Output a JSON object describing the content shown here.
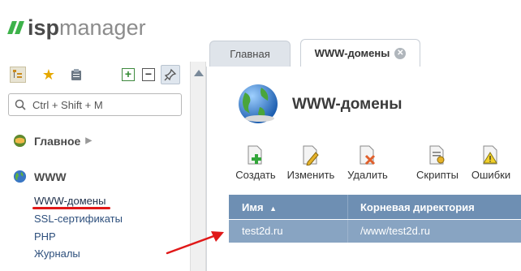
{
  "brand": {
    "isp": "isp",
    "manager": "manager",
    "accent": "#3db24a"
  },
  "toolbar": {
    "icons": [
      "tree-icon",
      "star-icon",
      "clipboard-icon",
      "expand-plus-icon",
      "collapse-minus-icon",
      "pin-icon"
    ]
  },
  "search": {
    "placeholder": "Ctrl + Shift + M"
  },
  "menu": {
    "main_label": "Главное",
    "www_label": "WWW",
    "items": [
      {
        "label": "WWW-домены"
      },
      {
        "label": "SSL-сертификаты"
      },
      {
        "label": "PHP"
      },
      {
        "label": "Журналы"
      }
    ]
  },
  "tabs": [
    {
      "label": "Главная"
    },
    {
      "label": "WWW-домены"
    }
  ],
  "page": {
    "title": "WWW-домены"
  },
  "actions": [
    {
      "label": "Создать"
    },
    {
      "label": "Изменить"
    },
    {
      "label": "Удалить"
    },
    {
      "label": "Скрипты"
    },
    {
      "label": "Ошибки"
    }
  ],
  "table": {
    "columns": [
      "Имя",
      "Корневая директория"
    ],
    "sort_indicator": "▲",
    "rows": [
      {
        "name": "test2d.ru",
        "root": "/www/test2d.ru"
      }
    ]
  },
  "colors": {
    "header_bg": "#6e8fb3",
    "selected_row": "#88a4c2",
    "annotation_red": "#e01818"
  }
}
